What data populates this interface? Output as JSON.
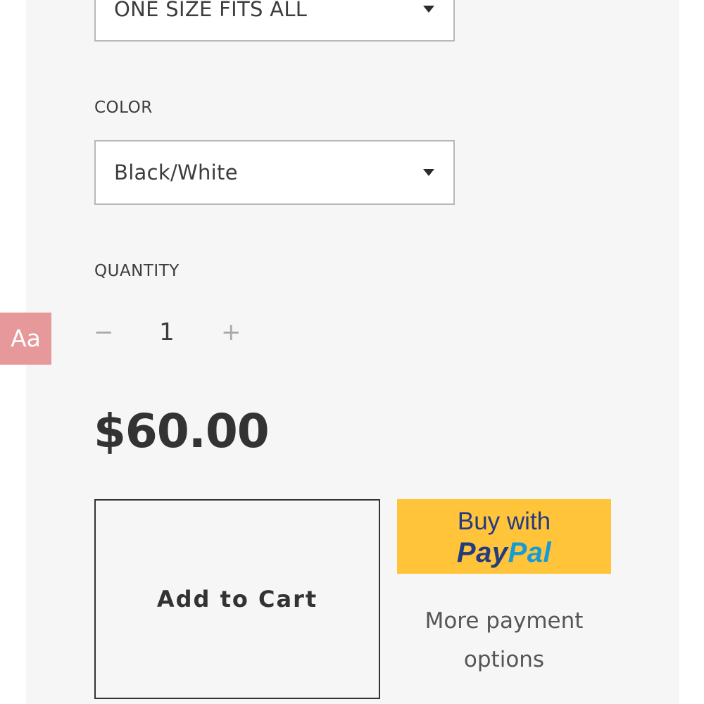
{
  "size": {
    "selected": "ONE SIZE FITS ALL",
    "icon": "chevron-down-icon"
  },
  "color": {
    "label": "COLOR",
    "selected": "Black/White",
    "icon": "chevron-down-icon"
  },
  "quantity": {
    "label": "QUANTITY",
    "decrement": "−",
    "value": "1",
    "increment": "+"
  },
  "font_toggle": {
    "label": "Aa",
    "bg_color": "#e6989a"
  },
  "price": "$60.00",
  "cart": {
    "add_label": "Add to Cart"
  },
  "paypal": {
    "prefix": "Buy with",
    "brand_part1": "Pay",
    "brand_part2": "Pal",
    "bg_color": "#ffc439",
    "dark_color": "#253b80",
    "light_color": "#179bd7"
  },
  "more_payment_options": "More payment options"
}
